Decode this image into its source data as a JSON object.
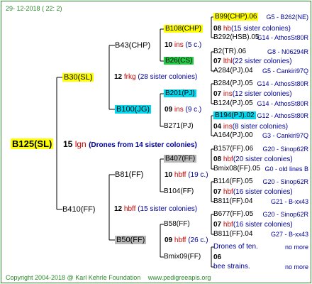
{
  "header": {
    "date": "29- 12-2018 ( 22: 2)"
  },
  "root": {
    "name": "B125(SL)",
    "count": "15",
    "line": "lgn",
    "note": "(Drones from 14 sister colonies)"
  },
  "g1": [
    {
      "name": "B30(SL)",
      "count": "12",
      "line": "frkg",
      "note": "(28 sister colonies)"
    },
    {
      "name": "B410(FF)",
      "count": "12",
      "line": "hbff",
      "note": "(15 sister colonies)"
    }
  ],
  "g2": [
    {
      "name": "B43(CHP)",
      "count": "10",
      "line": "ins",
      "note": "(5 c.)"
    },
    {
      "name": "B100(JG)",
      "count": "09",
      "line": "ins",
      "note": "(9 c.)"
    },
    {
      "name": "B81(FF)",
      "count": "10",
      "line": "hbff",
      "note": "(19 c.)"
    },
    {
      "name": "B50(FF)",
      "count": "09",
      "line": "hbff",
      "note": "(26 c.)"
    }
  ],
  "g3": [
    {
      "name": "B108(CHP)",
      "count": "08",
      "line": "hb",
      "note": "(15 sister colonies)"
    },
    {
      "name": "B26(CS)",
      "count": "07",
      "line": "lthl",
      "note": "(22 sister colonies)"
    },
    {
      "name": "B201(PJ)",
      "count": "07",
      "line": "ins",
      "note": "(12 sister colonies)"
    },
    {
      "name": "B271(PJ)",
      "count": "04",
      "line": "ins",
      "note": "(8 sister colonies)"
    },
    {
      "name": "B407(FF)",
      "count": "08",
      "line": "hbf",
      "note": "(20 sister colonies)"
    },
    {
      "name": "B104(FF)",
      "count": "07",
      "line": "hbf",
      "note": "(16 sister colonies)"
    },
    {
      "name": "B58(FF)",
      "count": "07",
      "line": "hbf",
      "note": "(16 sister colonies)"
    },
    {
      "name": "Bmix09(FF)",
      "count": "06",
      "line": "",
      "note": ""
    }
  ],
  "g4": [
    {
      "name": "B99(CHP).06",
      "ref": "G5 - B262(NE)"
    },
    {
      "name": "B292(HSB).05",
      "ref": "G14 - AthosSt80R"
    },
    {
      "name": "B2(TR).06",
      "ref": "G8 - N06294R"
    },
    {
      "name": "A284(PJ).04",
      "ref": "G5 - Cankiri97Q"
    },
    {
      "name": "B284(PJ).05",
      "ref": "G14 - AthosSt80R"
    },
    {
      "name": "B124(PJ).05",
      "ref": "G14 - AthosSt80R"
    },
    {
      "name": "B194(PJ).02",
      "ref": "G12 - AthosSt80R"
    },
    {
      "name": "A164(PJ).00",
      "ref": "G3 - Cankiri97Q"
    },
    {
      "name": "B157(FF).06",
      "ref": "G20 - Sinop62R"
    },
    {
      "name": "Bmix08(FF).05",
      "ref": "G0 - old lines B"
    },
    {
      "name": "B114(FF).05",
      "ref": "G20 - Sinop62R"
    },
    {
      "name": "B811(FF).04",
      "ref": "G21 - B-xx43"
    },
    {
      "name": "B677(FF).05",
      "ref": "G20 - Sinop62R"
    },
    {
      "name": "B811(FF).04",
      "ref": "G27 - B-xx43"
    },
    {
      "name": "Drones of ten.",
      "ref": "no more"
    },
    {
      "name": "bee strains.",
      "ref": "no more"
    }
  ],
  "footer": {
    "copyright": "Copyright 2004-2018 @ Karl Kehrle Foundation",
    "site": "www.pedigreeapis.org"
  },
  "colors": {
    "frame": "#2a8a2a",
    "yellow": "#ffff00",
    "green": "#22cc44",
    "cyan": "#00d8f0",
    "grey": "#b8b8b8",
    "red": "#cc0000",
    "blue": "#000099"
  }
}
